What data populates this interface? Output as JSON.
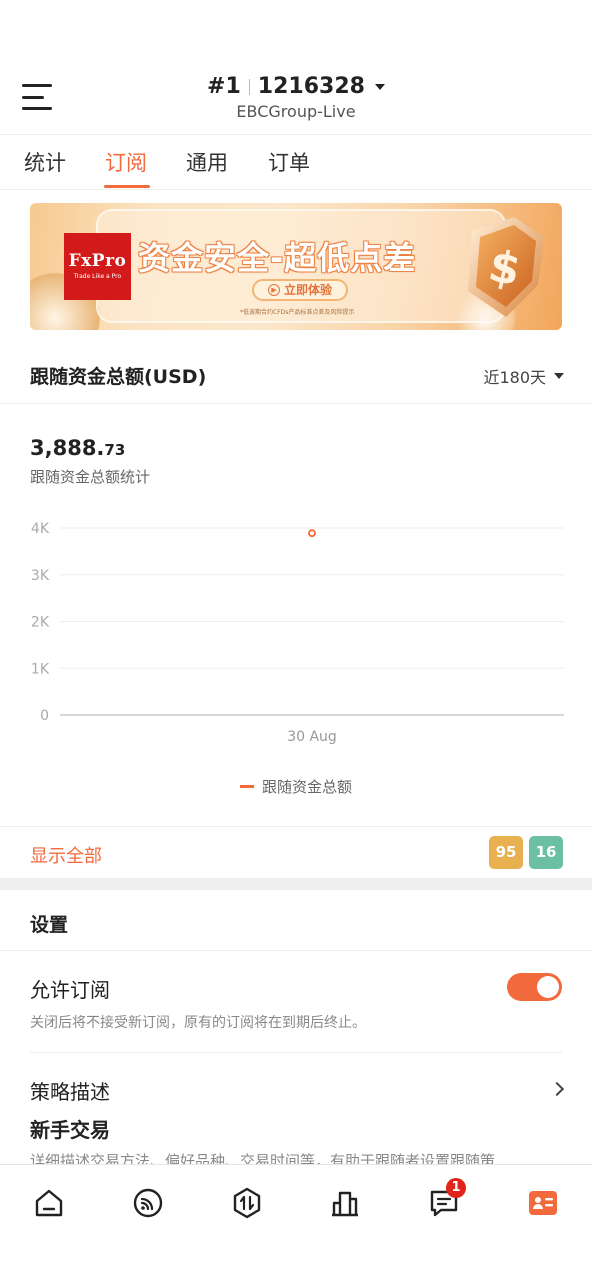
{
  "header": {
    "account_number": "#1",
    "account_id": "1216328",
    "server": "EBCGroup-Live"
  },
  "tabs": [
    {
      "label": "统计",
      "active": false
    },
    {
      "label": "订阅",
      "active": true
    },
    {
      "label": "通用",
      "active": false
    },
    {
      "label": "订单",
      "active": false
    }
  ],
  "banner": {
    "brand": "FxPro",
    "brand_tagline": "Trade Like a Pro",
    "title": "资金安全-超低点差",
    "cta": "立即体验",
    "note": "*低波期合约CFDs产品标准点差及风险提示"
  },
  "total": {
    "title": "跟随资金总额(USD)",
    "period": "近180天",
    "amount_main": "3,888.",
    "amount_decimal": "73",
    "amount_label": "跟随资金总额统计",
    "show_all": "显示全部",
    "badges": [
      {
        "value": "95",
        "color": "#e8b04f"
      },
      {
        "value": "16",
        "color": "#6bbfa3"
      }
    ]
  },
  "chart_data": {
    "type": "scatter",
    "categories": [
      "30 Aug"
    ],
    "y_ticks": [
      "4K",
      "3K",
      "2K",
      "1K",
      "0"
    ],
    "ylim": [
      0,
      4000
    ],
    "series": [
      {
        "name": "跟随资金总额",
        "color": "#f26a3c",
        "values": [
          3888.73
        ]
      }
    ],
    "legend_position": "bottom"
  },
  "settings": {
    "title": "设置",
    "allow_subscription_label": "允许订阅",
    "allow_subscription_desc": "关闭后将不接受新订阅，原有的订阅将在到期后终止。",
    "allow_subscription_on": true,
    "strategy_label": "策略描述",
    "strategy_name": "新手交易",
    "strategy_desc": "详细描述交易方法、偏好品种、交易时间等，有助于跟随者设置跟随策"
  },
  "bottom_nav": {
    "items": [
      "home-icon",
      "signal-icon",
      "trade-icon",
      "chart-icon",
      "messages-icon",
      "profile-card-icon"
    ],
    "messages_badge": "1",
    "active": "profile-card-icon",
    "accent": "#f26a3c"
  }
}
